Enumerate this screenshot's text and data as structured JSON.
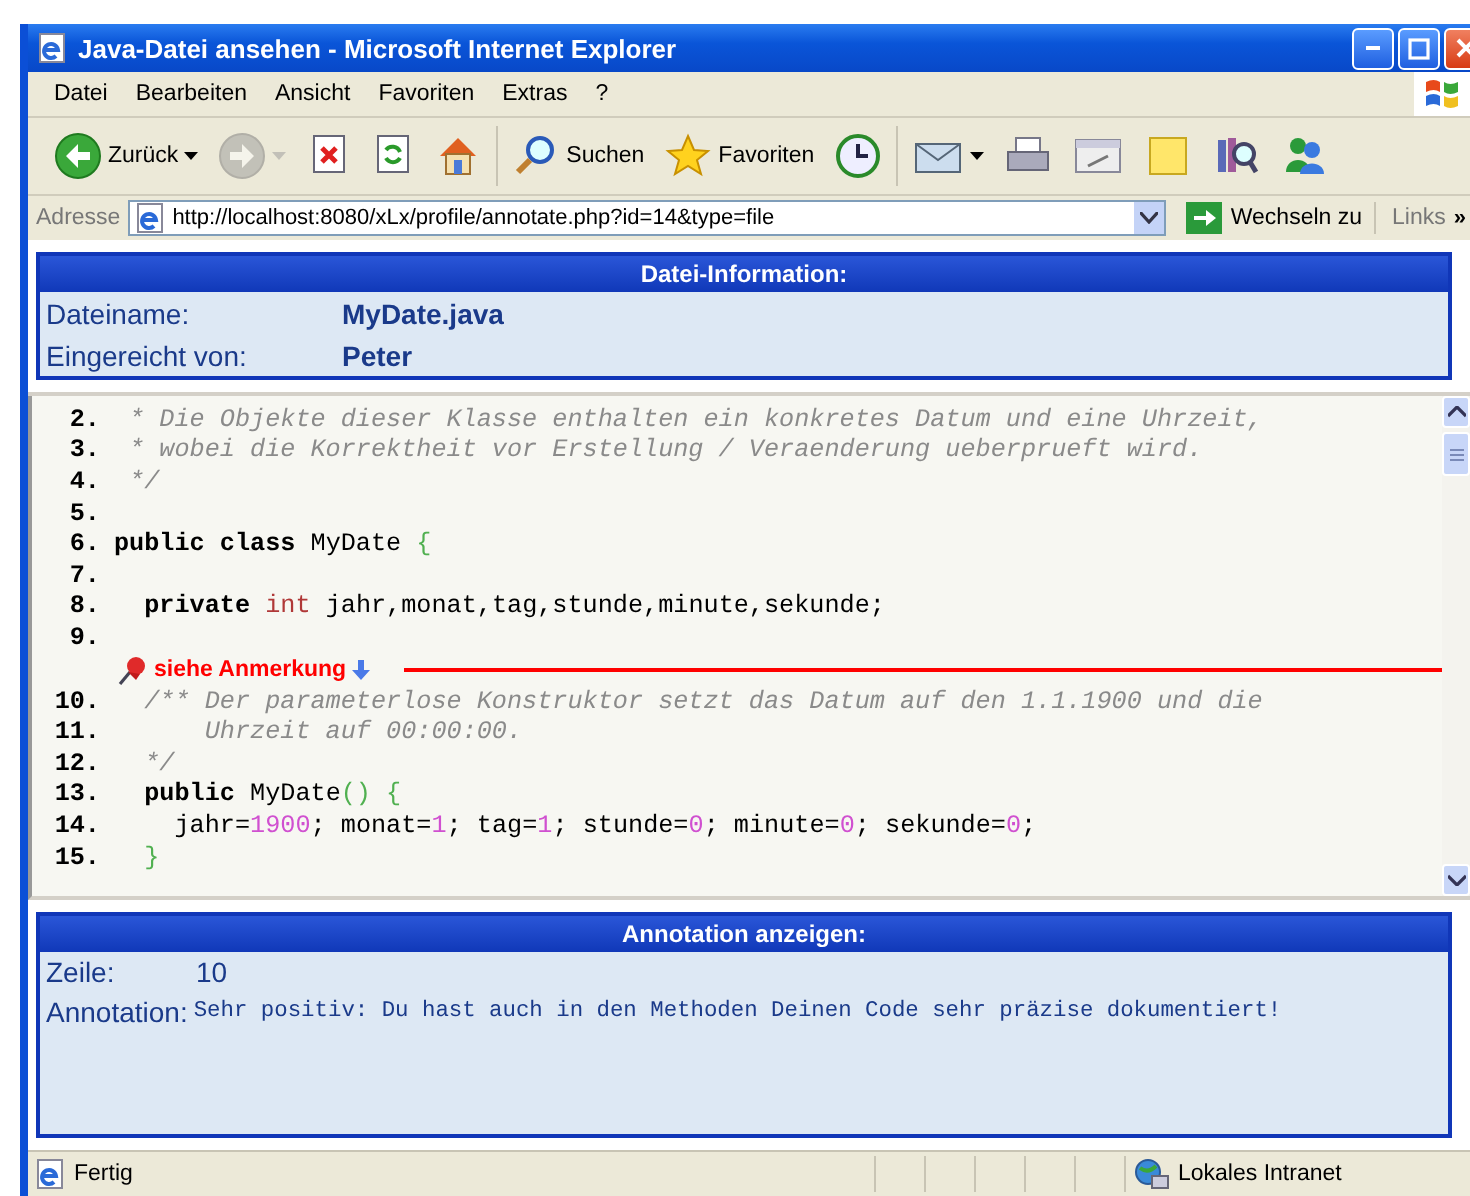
{
  "window": {
    "title": "Java-Datei ansehen - Microsoft Internet Explorer"
  },
  "menu": [
    "Datei",
    "Bearbeiten",
    "Ansicht",
    "Favoriten",
    "Extras",
    "?"
  ],
  "toolbar_groups": [
    {
      "buttons": [
        {
          "kind": "back",
          "label": "Zurück",
          "dropdown": true,
          "disabled": false
        },
        {
          "kind": "forward",
          "dropdown": true,
          "disabled": true
        },
        {
          "kind": "stop",
          "dropdown": false,
          "disabled": false
        },
        {
          "kind": "refresh",
          "dropdown": false,
          "disabled": false
        },
        {
          "kind": "home",
          "dropdown": false,
          "disabled": false
        }
      ]
    },
    {
      "buttons": [
        {
          "kind": "search",
          "label": "Suchen",
          "dropdown": false,
          "disabled": false
        },
        {
          "kind": "favorites",
          "label": "Favoriten",
          "dropdown": false,
          "disabled": false
        },
        {
          "kind": "history",
          "dropdown": false,
          "disabled": false
        }
      ]
    },
    {
      "buttons": [
        {
          "kind": "mail",
          "dropdown": true,
          "disabled": false
        },
        {
          "kind": "print",
          "dropdown": false,
          "disabled": false
        },
        {
          "kind": "edit",
          "dropdown": false,
          "disabled": false
        },
        {
          "kind": "note",
          "dropdown": false,
          "disabled": false
        },
        {
          "kind": "research",
          "dropdown": false,
          "disabled": false
        },
        {
          "kind": "messenger",
          "dropdown": false,
          "disabled": false
        }
      ]
    }
  ],
  "address_bar": {
    "label": "Adresse",
    "url": "http://localhost:8080/xLx/profile/annotate.php?id=14&type=file",
    "go": "Wechseln zu",
    "links": "Links",
    "more": "»"
  },
  "file_info": {
    "title": "Datei-Information:",
    "rows": [
      {
        "label": "Dateiname:",
        "value": "MyDate.java"
      },
      {
        "label": "Eingereicht von:",
        "value": "Peter"
      }
    ]
  },
  "code": [
    {
      "kind": "line",
      "number": "2.",
      "tokens": [
        {
          "kind": "comment",
          "text": " * Die Objekte dieser Klasse enthalten ein konkretes Datum und eine Uhrzeit,"
        }
      ]
    },
    {
      "kind": "line",
      "number": "3.",
      "tokens": [
        {
          "kind": "comment",
          "text": " * wobei die Korrektheit vor Erstellung / Veraenderung ueberprueft wird."
        }
      ]
    },
    {
      "kind": "line",
      "number": "4.",
      "tokens": [
        {
          "kind": "comment",
          "text": " */"
        }
      ]
    },
    {
      "kind": "line",
      "number": "5."
    },
    {
      "kind": "line",
      "number": "6.",
      "tokens": [
        {
          "kind": "keyword",
          "text": "public class"
        },
        {
          "kind": "plain",
          "text": " MyDate "
        },
        {
          "kind": "brace",
          "text": "{"
        }
      ]
    },
    {
      "kind": "line",
      "number": "7."
    },
    {
      "kind": "line",
      "number": "8.",
      "tokens": [
        {
          "kind": "keyword",
          "text": "  private"
        },
        {
          "kind": "type",
          "text": " int"
        },
        {
          "kind": "plain",
          "text": " jahr,monat,tag,stunde,minute,sekunde;"
        }
      ]
    },
    {
      "kind": "line",
      "number": "9."
    },
    {
      "kind": "marker",
      "label": "siehe Anmerkung"
    },
    {
      "kind": "line",
      "number": "10.",
      "tokens": [
        {
          "kind": "comment",
          "text": "  /** Der parameterlose Konstruktor setzt das Datum auf den 1.1.1900 und die"
        }
      ]
    },
    {
      "kind": "line",
      "number": "11.",
      "tokens": [
        {
          "kind": "comment",
          "text": "      Uhrzeit auf 00:00:00."
        }
      ]
    },
    {
      "kind": "line",
      "number": "12.",
      "tokens": [
        {
          "kind": "comment",
          "text": "  */"
        }
      ]
    },
    {
      "kind": "line",
      "number": "13.",
      "tokens": [
        {
          "kind": "keyword",
          "text": "  public"
        },
        {
          "kind": "plain",
          "text": " MyDate"
        },
        {
          "kind": "brace",
          "text": "() {"
        }
      ]
    },
    {
      "kind": "line",
      "number": "14.",
      "tokens": [
        {
          "kind": "plain",
          "text": "    jahr="
        },
        {
          "kind": "number",
          "text": "1900"
        },
        {
          "kind": "plain",
          "text": "; monat="
        },
        {
          "kind": "number",
          "text": "1"
        },
        {
          "kind": "plain",
          "text": "; tag="
        },
        {
          "kind": "number",
          "text": "1"
        },
        {
          "kind": "plain",
          "text": "; stunde="
        },
        {
          "kind": "number",
          "text": "0"
        },
        {
          "kind": "plain",
          "text": "; minute="
        },
        {
          "kind": "number",
          "text": "0"
        },
        {
          "kind": "plain",
          "text": "; sekunde="
        },
        {
          "kind": "number",
          "text": "0"
        },
        {
          "kind": "plain",
          "text": ";"
        }
      ]
    },
    {
      "kind": "line",
      "number": "15.",
      "tokens": [
        {
          "kind": "brace",
          "text": "  }"
        }
      ]
    }
  ],
  "annotation": {
    "title": "Annotation anzeigen:",
    "rows": [
      {
        "kind": "line",
        "label": "Zeile:",
        "value": "10"
      },
      {
        "kind": "text",
        "label": "Annotation:",
        "value": "Sehr positiv: Du hast auch in den Methoden Deinen Code sehr präzise dokumentiert!"
      }
    ]
  },
  "status_bar": {
    "text": "Fertig",
    "zone": "Lokales Intranet"
  }
}
